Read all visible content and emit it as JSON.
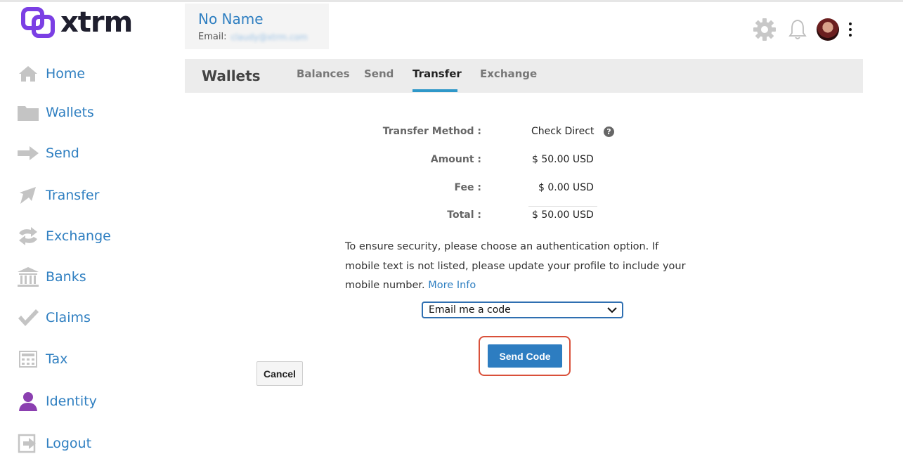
{
  "brand": {
    "name": "xtrm",
    "accent": "#7b3fe4"
  },
  "sidebar": {
    "items": [
      {
        "label": "Home",
        "icon": "home-icon"
      },
      {
        "label": "Wallets",
        "icon": "folder-icon"
      },
      {
        "label": "Send",
        "icon": "arrow-right-icon"
      },
      {
        "label": "Transfer",
        "icon": "transfer-arrow-icon"
      },
      {
        "label": "Exchange",
        "icon": "exchange-icon"
      },
      {
        "label": "Banks",
        "icon": "bank-icon"
      },
      {
        "label": "Claims",
        "icon": "checkmark-icon"
      },
      {
        "label": "Tax",
        "icon": "calculator-icon"
      },
      {
        "label": "Identity",
        "icon": "person-icon"
      },
      {
        "label": "Logout",
        "icon": "logout-icon"
      }
    ]
  },
  "header": {
    "user_name": "No Name",
    "email_label": "Email:",
    "email_value": "claudy@xtrm.com"
  },
  "tabs": {
    "title": "Wallets",
    "items": [
      {
        "label": "Balances"
      },
      {
        "label": "Send"
      },
      {
        "label": "Transfer",
        "active": true
      },
      {
        "label": "Exchange"
      }
    ]
  },
  "summary": {
    "method_label": "Transfer Method :",
    "method_value": "Check Direct",
    "amount_label": "Amount :",
    "amount_value": "$ 50.00 USD",
    "fee_label": "Fee :",
    "fee_value": "$ 0.00 USD",
    "total_label": "Total :",
    "total_value": "$ 50.00 USD"
  },
  "auth": {
    "message": "To ensure security, please choose an authentication option. If mobile text is not listed, please update your profile to include your mobile number.",
    "more_info": "More Info",
    "selected_option": "Email me a code"
  },
  "buttons": {
    "send_code": "Send Code",
    "cancel": "Cancel"
  },
  "colors": {
    "link_blue": "#2f7fc1",
    "tab_underline": "#2f98c9",
    "button_blue": "#2d7dc1",
    "highlight_red": "#d9503a"
  }
}
